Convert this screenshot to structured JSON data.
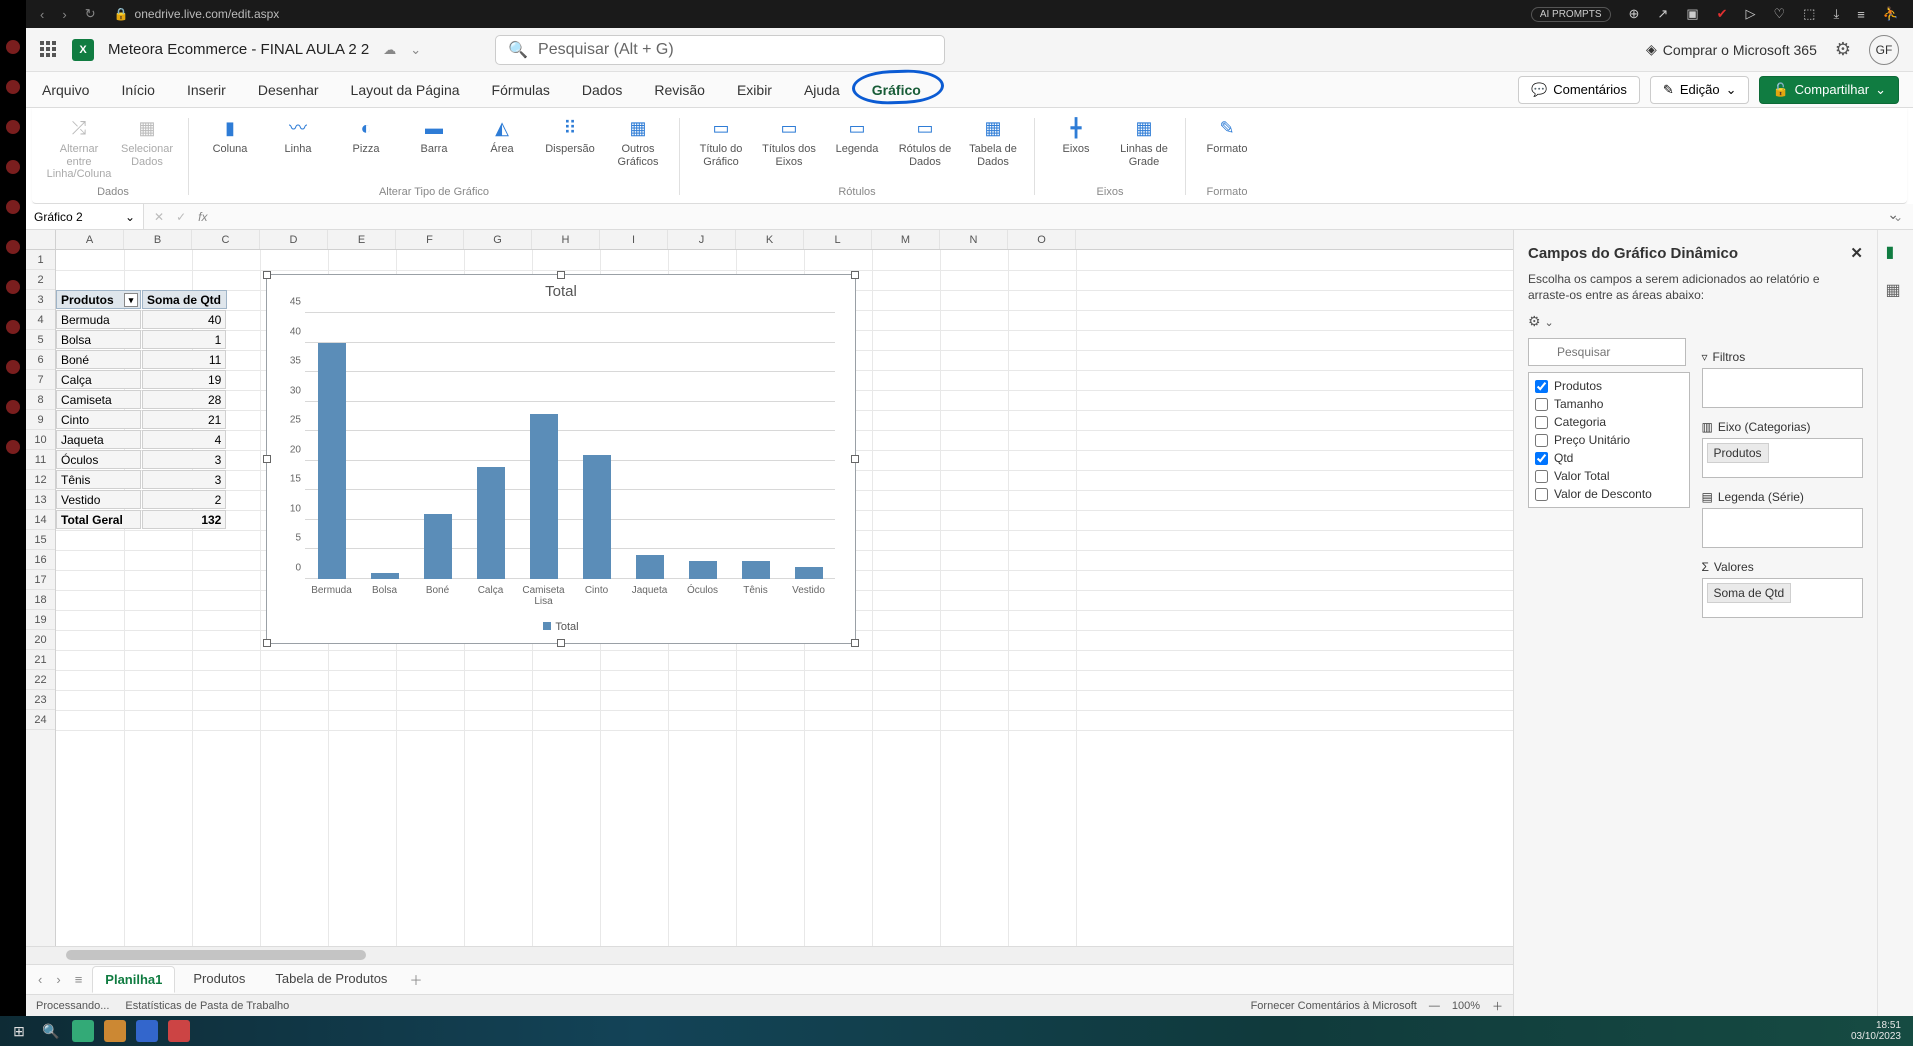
{
  "browser": {
    "url": "onedrive.live.com/edit.aspx",
    "ai_prompts": "AI PROMPTS"
  },
  "titlebar": {
    "doc_name": "Meteora Ecommerce - FINAL AULA 2 2",
    "search_placeholder": "Pesquisar (Alt + G)",
    "premium": "Comprar o Microsoft 365",
    "avatar": "GF"
  },
  "tabs": {
    "items": [
      "Arquivo",
      "Início",
      "Inserir",
      "Desenhar",
      "Layout da Página",
      "Fórmulas",
      "Dados",
      "Revisão",
      "Exibir",
      "Ajuda",
      "Gráfico"
    ],
    "active_index": 10,
    "comentarios": "Comentários",
    "edicao": "Edição",
    "compartilhar": "Compartilhar"
  },
  "ribbon": {
    "dados_items": [
      "Alternar entre Linha/Coluna",
      "Selecionar Dados"
    ],
    "tipo_items": [
      "Coluna",
      "Linha",
      "Pizza",
      "Barra",
      "Área",
      "Dispersão",
      "Outros Gráficos"
    ],
    "rotulos_items": [
      "Título do Gráfico",
      "Títulos dos Eixos",
      "Legenda",
      "Rótulos de Dados",
      "Tabela de Dados"
    ],
    "eixos_items": [
      "Eixos",
      "Linhas de Grade"
    ],
    "formato_items": [
      "Formato"
    ],
    "group_labels": [
      "Dados",
      "Alterar Tipo de Gráfico",
      "Rótulos",
      "Eixos",
      "Formato"
    ]
  },
  "namebox": "Gráfico 2",
  "columns": [
    "A",
    "B",
    "C",
    "D",
    "E",
    "F",
    "G",
    "H",
    "I",
    "J",
    "K",
    "L",
    "M",
    "N",
    "O"
  ],
  "pivot": {
    "headers": [
      "Produtos",
      "Soma de Qtd"
    ],
    "rows": [
      [
        "Bermuda",
        "40"
      ],
      [
        "Bolsa",
        "1"
      ],
      [
        "Boné",
        "11"
      ],
      [
        "Calça",
        "19"
      ],
      [
        "Camiseta Lisa",
        "28"
      ],
      [
        "Cinto",
        "21"
      ],
      [
        "Jaqueta",
        "4"
      ],
      [
        "Óculos",
        "3"
      ],
      [
        "Tênis",
        "3"
      ],
      [
        "Vestido",
        "2"
      ]
    ],
    "total_label": "Total Geral",
    "total_value": "132"
  },
  "chart_data": {
    "type": "bar",
    "title": "Total",
    "legend": "Total",
    "categories": [
      "Bermuda",
      "Bolsa",
      "Boné",
      "Calça",
      "Camiseta Lisa",
      "Cinto",
      "Jaqueta",
      "Óculos",
      "Tênis",
      "Vestido"
    ],
    "values": [
      40,
      1,
      11,
      19,
      28,
      21,
      4,
      3,
      3,
      2
    ],
    "yticks": [
      0,
      5,
      10,
      15,
      20,
      25,
      30,
      35,
      40,
      45
    ],
    "ylim": [
      0,
      45
    ]
  },
  "sheet_tabs": {
    "items": [
      "Planilha1",
      "Produtos",
      "Tabela de Produtos"
    ],
    "active_index": 0
  },
  "status": {
    "left1": "Processando...",
    "left2": "Estatísticas de Pasta de Trabalho",
    "right1": "Fornecer Comentários à Microsoft",
    "zoom": "100%"
  },
  "panel": {
    "title": "Campos do Gráfico Dinâmico",
    "desc": "Escolha os campos a serem adicionados ao relatório e arraste-os entre as áreas abaixo:",
    "search_placeholder": "Pesquisar",
    "fields": [
      {
        "label": "Produtos",
        "checked": true
      },
      {
        "label": "Tamanho",
        "checked": false
      },
      {
        "label": "Categoria",
        "checked": false
      },
      {
        "label": "Preço Unitário",
        "checked": false
      },
      {
        "label": "Qtd",
        "checked": true
      },
      {
        "label": "Valor Total",
        "checked": false
      },
      {
        "label": "Valor de Desconto",
        "checked": false
      }
    ],
    "areas": {
      "filtros": "Filtros",
      "eixo": "Eixo (Categorias)",
      "eixo_pill": "Produtos",
      "legenda": "Legenda (Série)",
      "valores": "Valores",
      "valores_pill": "Soma de Qtd"
    }
  },
  "clock": {
    "time": "18:51",
    "date": "03/10/2023"
  }
}
